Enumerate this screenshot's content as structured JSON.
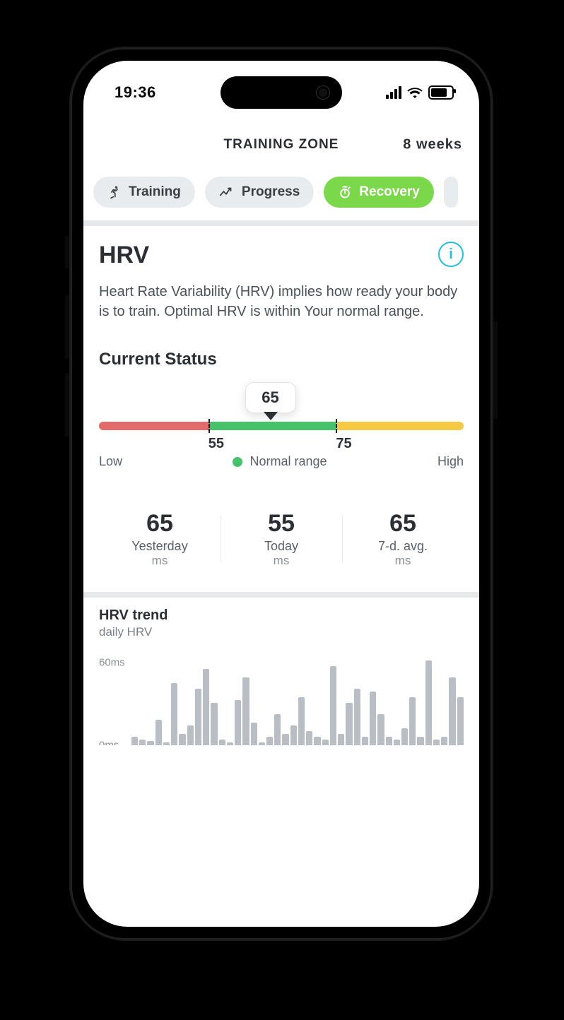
{
  "status_bar": {
    "time": "19:36"
  },
  "header": {
    "title": "TRAINING ZONE",
    "right_label": "8 weeks"
  },
  "tabs": {
    "training": {
      "label": "Training",
      "active": false
    },
    "progress": {
      "label": "Progress",
      "active": false
    },
    "recovery": {
      "label": "Recovery",
      "active": true
    }
  },
  "hrv": {
    "title": "HRV",
    "description": "Heart Rate Variability (HRV) implies how ready your body is to train. Optimal HRV is within Your normal range.",
    "current_status_label": "Current Status",
    "range": {
      "low_bound": 55,
      "high_bound": 75,
      "marker_value": 65,
      "low_label": "Low",
      "mid_label": "Normal range",
      "high_label": "High",
      "low_bound_label": "55",
      "high_bound_label": "75",
      "seg_low_width_pct": 30,
      "seg_mid_width_pct": 35,
      "seg_high_width_pct": 35,
      "marker_left_pct": 47,
      "tick_low_left_pct": 30,
      "tick_high_left_pct": 65
    },
    "stats": {
      "yesterday": {
        "value": "65",
        "label": "Yesterday",
        "unit": "ms"
      },
      "today": {
        "value": "55",
        "label": "Today",
        "unit": "ms"
      },
      "avg7d": {
        "value": "65",
        "label": "7-d. avg.",
        "unit": "ms"
      }
    }
  },
  "trend": {
    "title": "HRV trend",
    "subtitle": "daily HRV",
    "y_top_label": "60ms",
    "y_bottom_label": "0ms",
    "y_top_pct": 10,
    "y_bottom_pct": 100
  },
  "chart_data": {
    "type": "bar",
    "title": "HRV trend — daily HRV",
    "ylabel": "ms",
    "ylim": [
      0,
      60
    ],
    "series": [
      {
        "name": "daily HRV",
        "values": [
          6,
          4,
          3,
          18,
          2,
          44,
          8,
          14,
          40,
          54,
          30,
          4,
          2,
          32,
          48,
          16,
          2,
          6,
          22,
          8,
          14,
          34,
          10,
          6,
          4,
          56,
          8,
          30,
          40,
          6,
          38,
          22,
          6,
          4,
          12,
          34,
          6,
          60,
          4,
          6,
          48,
          34
        ]
      }
    ]
  },
  "colors": {
    "accent_green": "#7bd84a",
    "range_red": "#e36b6b",
    "range_green": "#46c26a",
    "range_yellow": "#f6c945",
    "info_cyan": "#1fbfe0"
  }
}
